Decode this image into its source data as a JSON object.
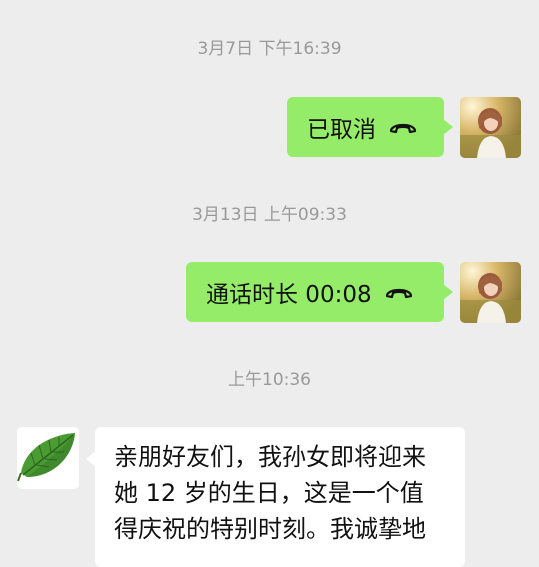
{
  "chat": {
    "timestamps": [
      "3月7日 下午16:39",
      "3月13日 上午09:33",
      "上午10:36"
    ],
    "messages": [
      {
        "direction": "outgoing",
        "type": "call",
        "text": "已取消",
        "icon": "phone-hangup-icon"
      },
      {
        "direction": "outgoing",
        "type": "call",
        "text": "通话时长 00:08",
        "icon": "phone-hangup-icon"
      },
      {
        "direction": "incoming",
        "type": "text",
        "text": "亲朋好友们，我孙女即将迎来她 12 岁的生日，这是一个值得庆祝的特别时刻。我诚挚地"
      }
    ]
  },
  "colors": {
    "background": "#ededed",
    "outgoing_bubble": "#95ec69",
    "incoming_bubble": "#ffffff",
    "timestamp_text": "#999999",
    "message_text": "#111111"
  },
  "avatars": {
    "self": "girl-photo-avatar",
    "contact": "green-leaf-avatar"
  }
}
